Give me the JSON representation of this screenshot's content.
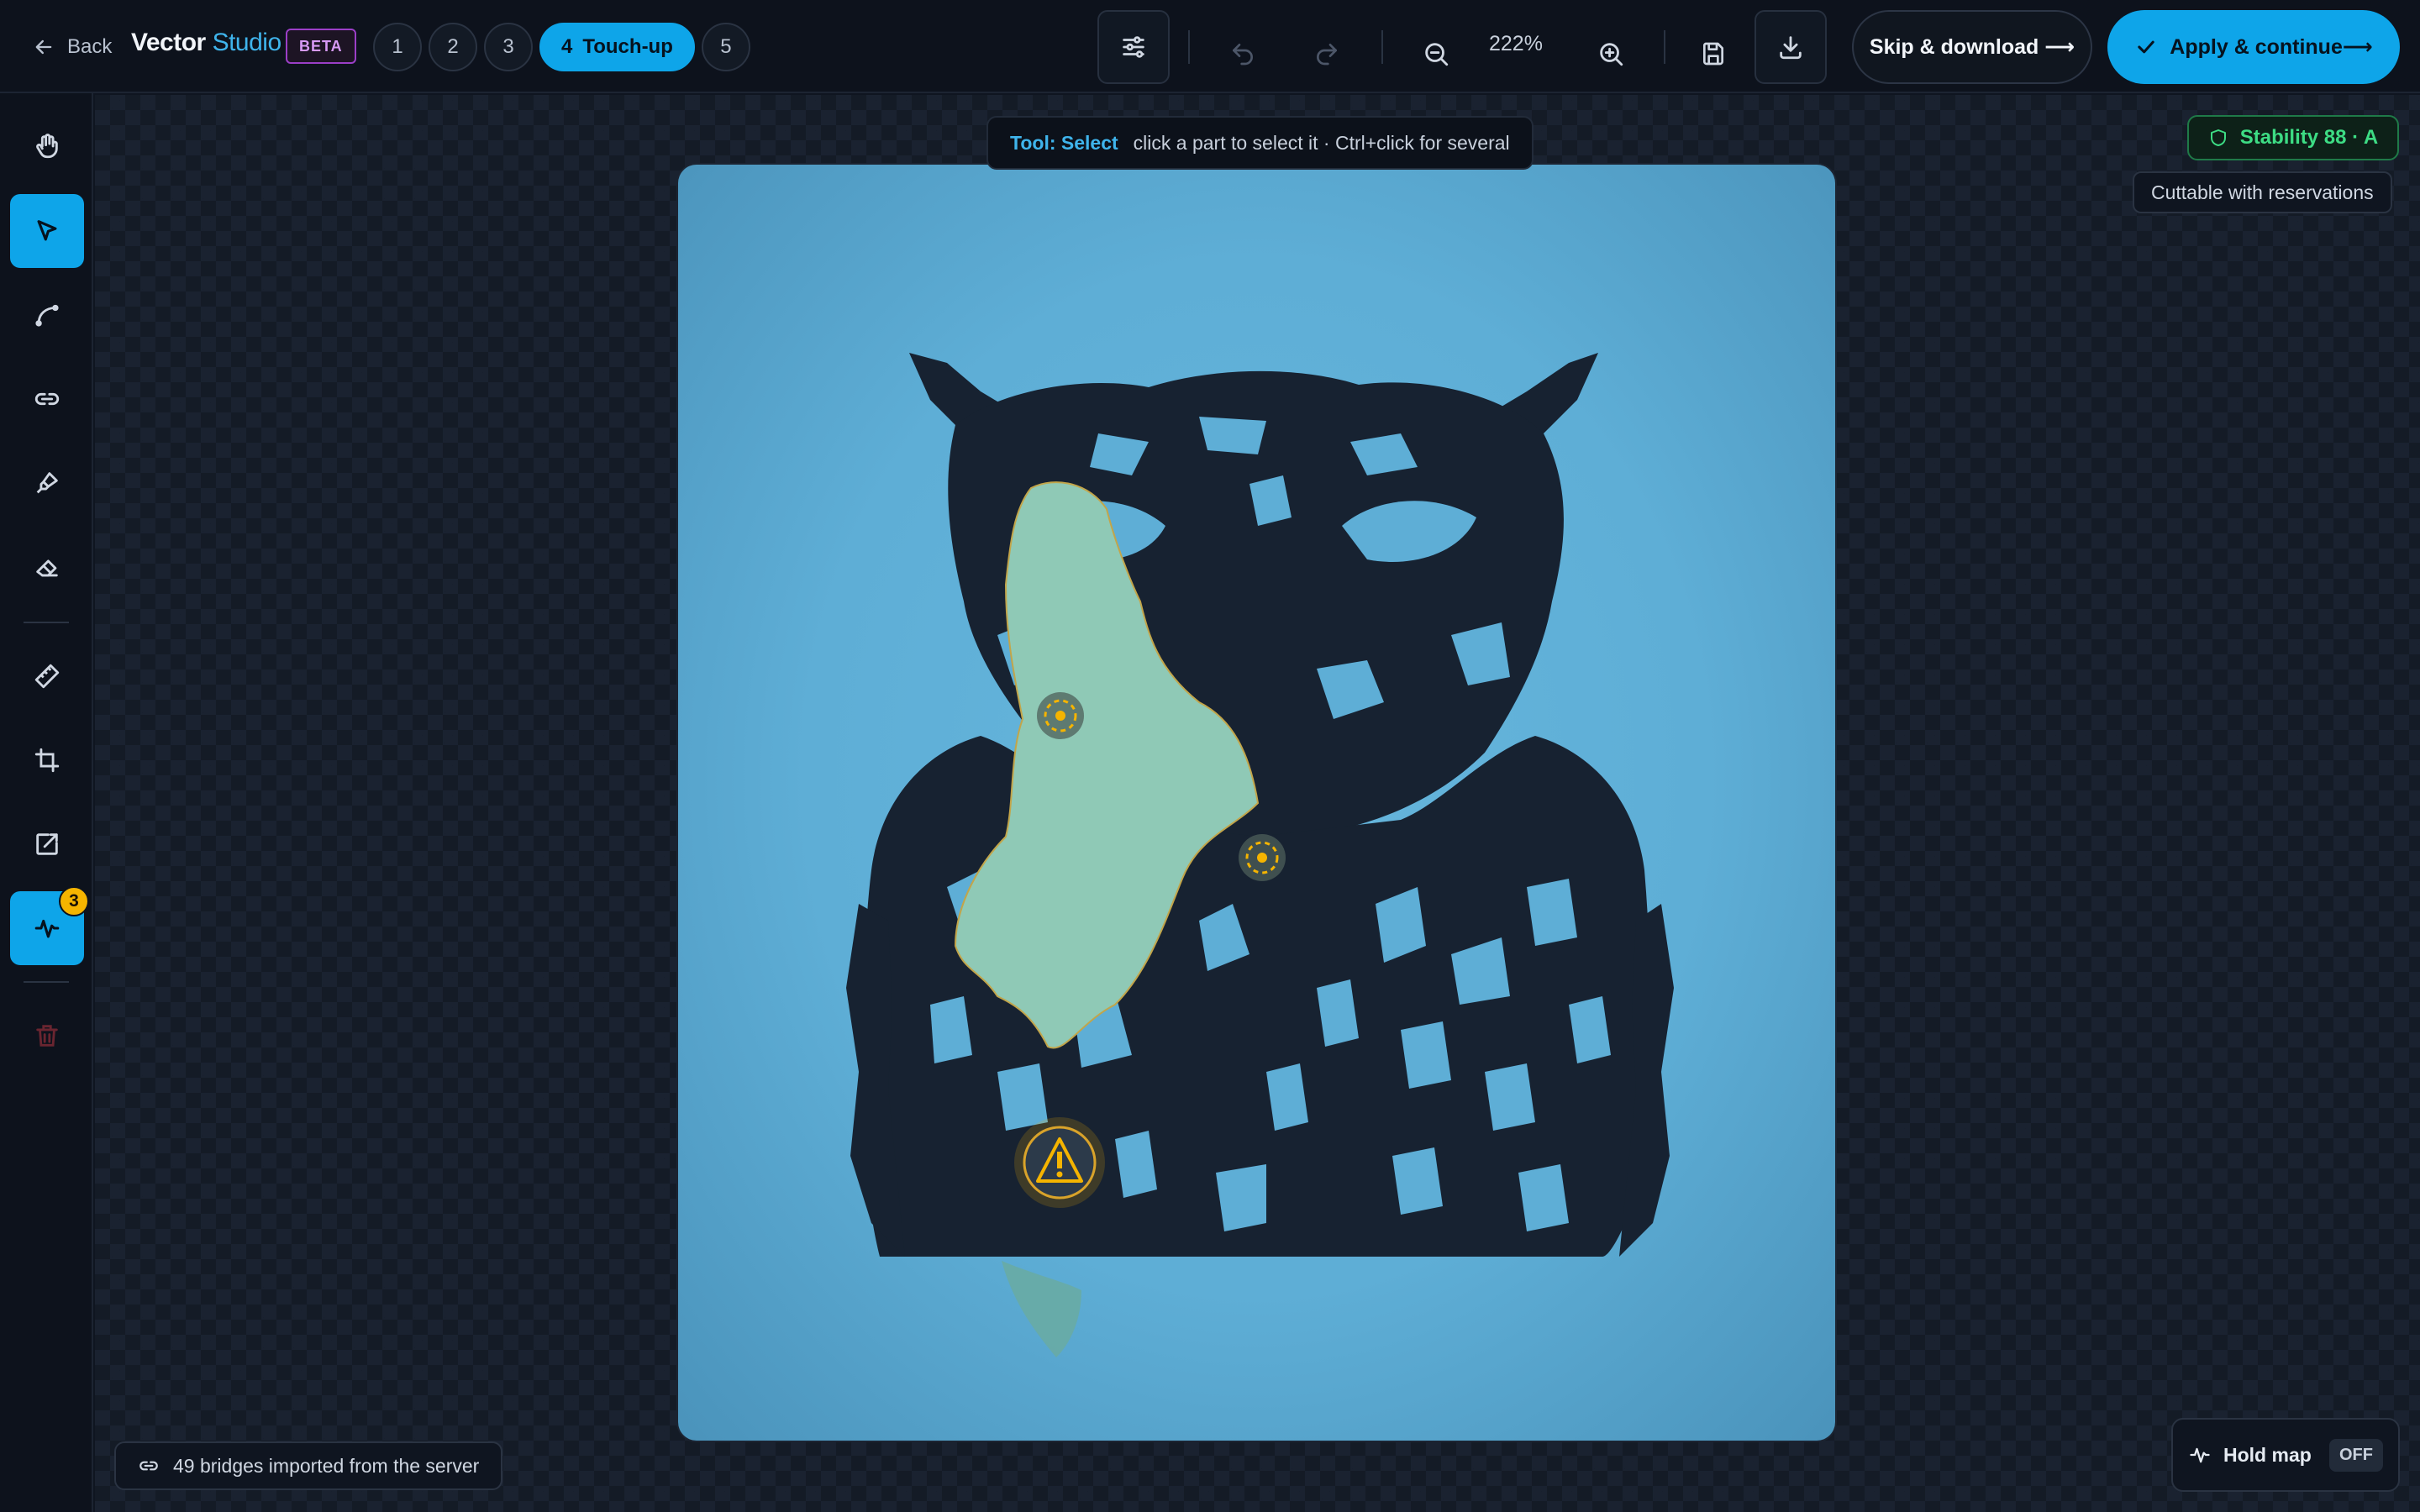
{
  "header": {
    "back_label": "Back",
    "brand_primary": "Vector",
    "brand_secondary": "Studio",
    "beta_badge": "BETA",
    "steps": [
      {
        "label": "1"
      },
      {
        "label": "2"
      },
      {
        "label": "3"
      },
      {
        "number": "4",
        "label": "Touch-up"
      },
      {
        "label": "5"
      }
    ],
    "zoom": "222%",
    "skip_label": "Skip & download ⟶",
    "apply_label": "Apply & continue⟶"
  },
  "toolbar": {
    "tools": [
      {
        "name": "hand-icon"
      },
      {
        "name": "select-pointer-icon",
        "active": true
      },
      {
        "name": "curve-path-icon"
      },
      {
        "name": "link-icon"
      },
      {
        "name": "brush-icon"
      },
      {
        "name": "eraser-icon"
      },
      {
        "name": "ruler-icon"
      },
      {
        "name": "crop-icon"
      },
      {
        "name": "export-edit-icon"
      },
      {
        "name": "activity-pulse-icon",
        "active": true,
        "badge": "3"
      },
      {
        "name": "trash-icon",
        "disabled": true
      }
    ]
  },
  "canvas": {
    "hint_tool": "Tool: Select",
    "hint_text": "click a part to select it · Ctrl+click for several"
  },
  "status": {
    "stability": "Stability 88 · A",
    "cuttable": "Cuttable with reservations",
    "bridges": "49 bridges imported from the server",
    "hold_map_label": "Hold map",
    "hold_map_state": "OFF"
  },
  "colors": {
    "accent": "#0ea5e9",
    "artboard": "#5eaed6",
    "owl_ink": "#172231",
    "selection_fill": "#8fc9b6",
    "warning": "#f5b400",
    "stability_green": "#3ddc84"
  }
}
